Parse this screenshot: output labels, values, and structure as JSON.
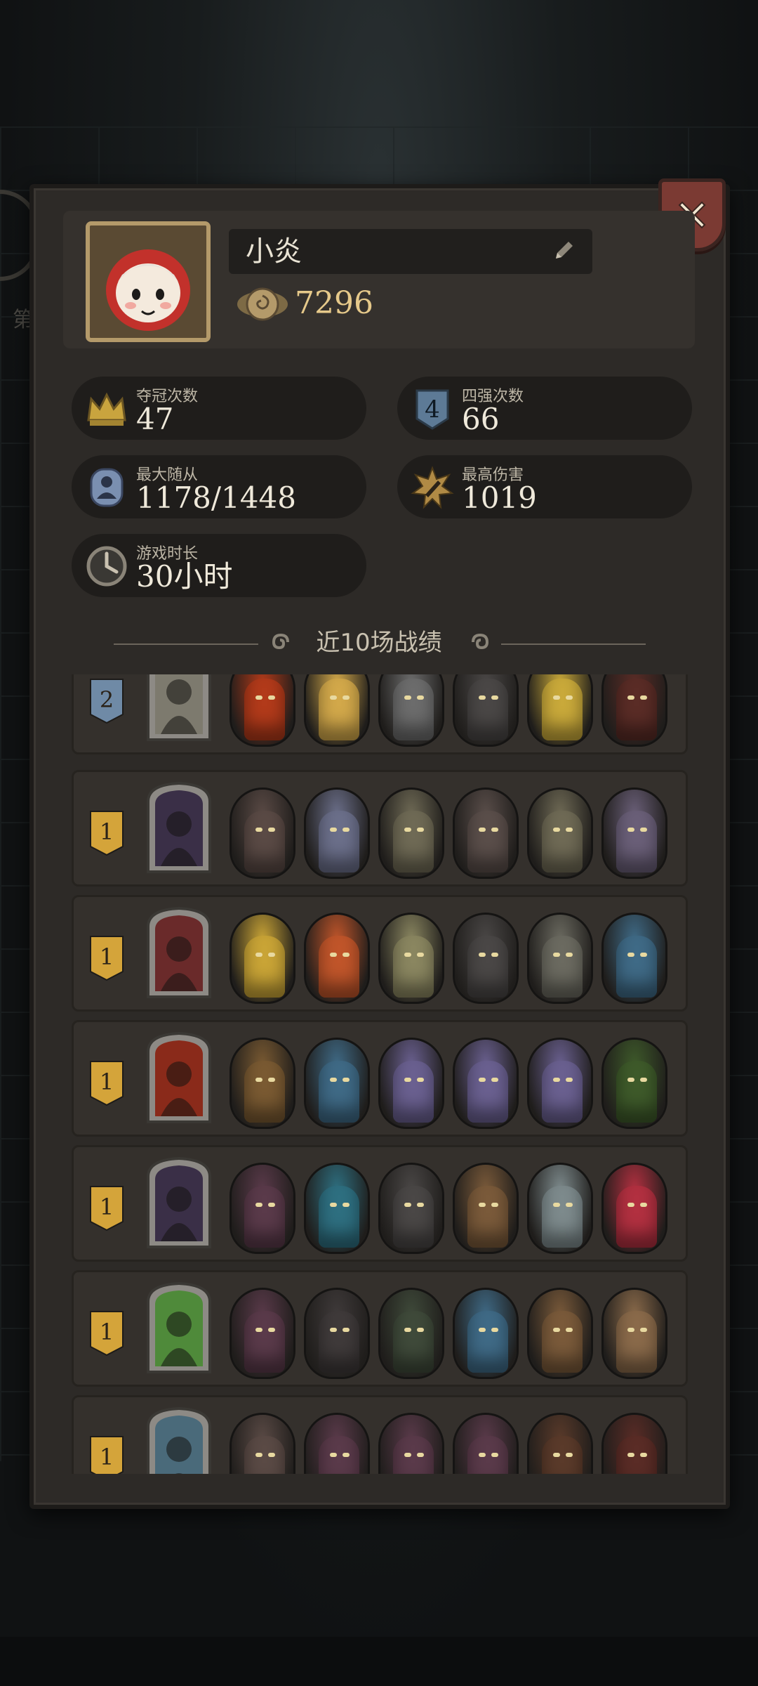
{
  "profile": {
    "name": "小炎",
    "coins": "7296"
  },
  "stats": [
    {
      "label": "夺冠次数",
      "value": "47",
      "icon": "crown-icon"
    },
    {
      "label": "四强次数",
      "value": "66",
      "icon": "top4-shield-icon"
    },
    {
      "label": "最大随从",
      "value": "1178/1448",
      "icon": "minion-icon"
    },
    {
      "label": "最高伤害",
      "value": "1019",
      "icon": "damage-icon"
    },
    {
      "label": "游戏时长",
      "value": "30小时",
      "icon": "clock-icon"
    }
  ],
  "section_title": "近10场战绩",
  "background_hint": "第",
  "matches": [
    {
      "rank": "2",
      "rank_color": "#6f8aa6",
      "hero_color": "#7d7a6e",
      "units": [
        "#b23a1a",
        "#d2a84a",
        "#6c6c6c",
        "#4a4746",
        "#c9a93a",
        "#5a2c26"
      ]
    },
    {
      "rank": "1",
      "rank_color": "#d4a43a",
      "hero_color": "#3a2f47",
      "units": [
        "#5a4a45",
        "#6b6f8a",
        "#6f6a55",
        "#5a4e4a",
        "#6f6a55",
        "#6a5f78"
      ]
    },
    {
      "rank": "1",
      "rank_color": "#d4a43a",
      "hero_color": "#6a2a2a",
      "units": [
        "#c9a436",
        "#c0552a",
        "#8a8660",
        "#4a4746",
        "#6b6a60",
        "#3f6a86"
      ]
    },
    {
      "rank": "1",
      "rank_color": "#d4a43a",
      "hero_color": "#8a2a1a",
      "units": [
        "#7a5a32",
        "#3f6a86",
        "#6a6090",
        "#6a6090",
        "#6a6090",
        "#3e5a2a"
      ]
    },
    {
      "rank": "1",
      "rank_color": "#d4a43a",
      "hero_color": "#3a2f47",
      "units": [
        "#5a3a4a",
        "#2e6f80",
        "#4a4746",
        "#7a5a3a",
        "#7d8a8c",
        "#b23040"
      ]
    },
    {
      "rank": "1",
      "rank_color": "#d4a43a",
      "hero_color": "#4f8a3a",
      "units": [
        "#5a3a4a",
        "#3f3a3a",
        "#3f4a3a",
        "#3f6a86",
        "#7a5a3a",
        "#8a6a4a"
      ]
    },
    {
      "rank": "1",
      "rank_color": "#d4a43a",
      "hero_color": "#4a6a7a",
      "units": [
        "#5a4a45",
        "#5a3a4a",
        "#5a3a4a",
        "#5a3a4a",
        "#5a3a2a",
        "#5a2c26"
      ]
    }
  ]
}
